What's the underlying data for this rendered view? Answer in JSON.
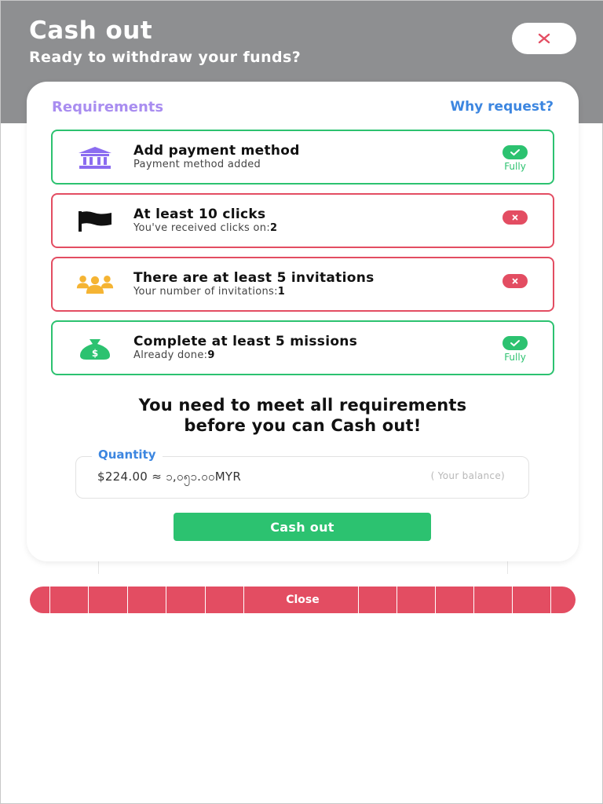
{
  "header": {
    "title": "Cash out",
    "subtitle": "Ready to withdraw your funds?"
  },
  "modal": {
    "requirements_title": "Requirements",
    "why_link": "Why request?",
    "requirements": [
      {
        "icon": "bank-icon",
        "name": "Add payment method",
        "detail": "Payment method added",
        "detail_value": "",
        "status": "ok",
        "status_text": "Fully"
      },
      {
        "icon": "flag-icon",
        "name": "At least 10 clicks",
        "detail": "You've received clicks on:",
        "detail_value": "2",
        "status": "fail",
        "status_text": ""
      },
      {
        "icon": "users-icon",
        "name": "There are at least 5 invitations",
        "detail": "Your number of invitations:",
        "detail_value": "1",
        "status": "fail",
        "status_text": ""
      },
      {
        "icon": "money-bag-icon",
        "name": "Complete at least 5 missions",
        "detail": "Already done:",
        "detail_value": "9",
        "status": "ok",
        "status_text": "Fully"
      }
    ],
    "warning_line1": "You need to meet all requirements",
    "warning_line2": "before you can Cash out!",
    "quantity_label": "Quantity",
    "quantity_value": "$224.00 ≈ ၁,၀၅၁.၀၀MYR",
    "quantity_hint": "( Your balance)",
    "cashout_label": "Cash out"
  },
  "footer": {
    "close_label": "Close"
  },
  "colors": {
    "ok": "#2cc270",
    "fail": "#e34d62",
    "accent_blue": "#3c86e0",
    "accent_purple": "#a98df0",
    "bank_icon": "#8b6cf0",
    "users_icon": "#f5b433",
    "money_icon": "#2cc270"
  }
}
